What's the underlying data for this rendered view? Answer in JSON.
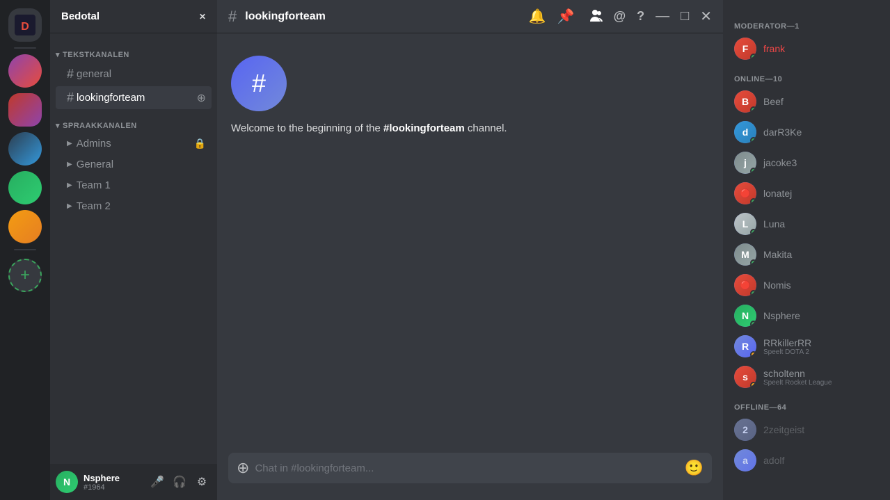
{
  "server": {
    "name": "Bedotal",
    "dropdown_icon": "▾"
  },
  "header": {
    "channel_hash": "#",
    "channel_name": "lookingforteam",
    "icons": {
      "bell": "🔔",
      "pin": "📌",
      "members": "👥",
      "mention": "@",
      "help": "?"
    }
  },
  "sidebar": {
    "text_channels_label": "TEKSTKANALEN",
    "voice_channels_label": "SPRAAKKANALEN",
    "channels": [
      {
        "name": "general",
        "active": false
      },
      {
        "name": "lookingforteam",
        "active": true
      }
    ],
    "voice_channels": [
      {
        "name": "Admins"
      },
      {
        "name": "General"
      },
      {
        "name": "Team 1"
      },
      {
        "name": "Team 2"
      }
    ]
  },
  "welcome": {
    "text_before": "Welcome to the beginning of the ",
    "channel_name": "#lookingforteam",
    "text_after": " channel."
  },
  "chat_input": {
    "placeholder": "Chat in #lookingforteam..."
  },
  "members": {
    "moderator_label": "MODERATOR—1",
    "online_label": "ONLINE—10",
    "offline_label": "OFFLINE—64",
    "moderators": [
      {
        "name": "frank",
        "color_class": "av-frank"
      }
    ],
    "online": [
      {
        "name": "Beef",
        "color_class": "av-beef"
      },
      {
        "name": "darR3Ke",
        "color_class": "av-darr3ke"
      },
      {
        "name": "jacoke3",
        "color_class": "av-jacoke"
      },
      {
        "name": "lonatej",
        "color_class": "av-lonatej"
      },
      {
        "name": "Luna",
        "color_class": "av-luna"
      },
      {
        "name": "Makita",
        "color_class": "av-makita"
      },
      {
        "name": "Nomis",
        "color_class": "av-nomis"
      },
      {
        "name": "Nsphere",
        "color_class": "av-nsphere"
      },
      {
        "name": "RRkillerRR",
        "subtext": "Speelt DOTA 2",
        "color_class": "av-rrkiller"
      },
      {
        "name": "scholtenn",
        "subtext": "Speelt Rocket League",
        "color_class": "av-scholtenn"
      }
    ],
    "offline": [
      {
        "name": "2zeitgeist",
        "color_class": "av-2zeitgeist"
      },
      {
        "name": "adolf",
        "color_class": "av-adolf"
      }
    ]
  },
  "user_panel": {
    "name": "Nsphere",
    "tag": "#1964",
    "color_class": "av-nsphere-panel"
  },
  "server_icons": [
    {
      "label": "Bedotal",
      "color_class": "sv-bedotal",
      "text": "⬢",
      "active": true
    },
    {
      "label": "Server 2",
      "color_class": "sv-avatar1",
      "text": ""
    },
    {
      "label": "Server 3",
      "color_class": "sv-avatar2",
      "text": ""
    },
    {
      "label": "Server 4",
      "color_class": "sv-avatar3",
      "text": ""
    },
    {
      "label": "Server 5",
      "color_class": "sv-avatar4",
      "text": ""
    },
    {
      "label": "Server 6",
      "color_class": "sv-avatar5",
      "text": ""
    }
  ],
  "add_server_label": "+"
}
